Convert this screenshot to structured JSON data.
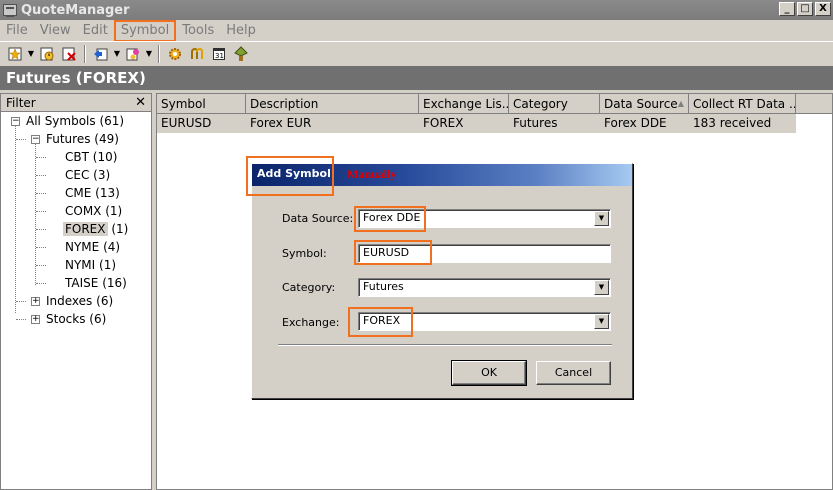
{
  "window": {
    "title": "QuoteManager",
    "buttons": [
      "_",
      "□",
      "X"
    ]
  },
  "menu": {
    "items": [
      "File",
      "View",
      "Edit",
      "Symbol",
      "Tools",
      "Help"
    ],
    "active": "Symbol"
  },
  "toolbar": {
    "icons": [
      "star-document-icon",
      "clock-icon",
      "delete-icon",
      "import-icon",
      "export-icon",
      "gear-icon",
      "split-icon",
      "calendar-icon",
      "plugin-icon"
    ]
  },
  "header": {
    "title": "Futures (FOREX)"
  },
  "filter": {
    "title": "Filter",
    "close": "✕",
    "tree": [
      {
        "label": "All Symbols",
        "count": "(61)"
      },
      {
        "label": "Futures",
        "count": "(49)"
      },
      {
        "label": "CBT",
        "count": "(10)"
      },
      {
        "label": "CEC",
        "count": "(3)"
      },
      {
        "label": "CME",
        "count": "(13)"
      },
      {
        "label": "COMX",
        "count": "(1)"
      },
      {
        "label": "FOREX",
        "count": "(1)"
      },
      {
        "label": "NYME",
        "count": "(4)"
      },
      {
        "label": "NYMI",
        "count": "(1)"
      },
      {
        "label": "TAISE",
        "count": "(16)"
      },
      {
        "label": "Indexes",
        "count": "(6)"
      },
      {
        "label": "Stocks",
        "count": "(6)"
      }
    ]
  },
  "grid": {
    "columns": [
      "Symbol",
      "Description",
      "Exchange Lis...",
      "Category",
      "Data Source",
      "Collect RT Data ..."
    ],
    "sort_indicator": "▲",
    "rows": [
      [
        "EURUSD",
        "Forex EUR",
        "FOREX",
        "Futures",
        "Forex DDE",
        "183 received"
      ]
    ]
  },
  "dialog": {
    "title": "Add Symbol",
    "annotation": "Manually",
    "fields": {
      "data_source": {
        "label": "Data Source:",
        "value": "Forex DDE"
      },
      "symbol": {
        "label": "Symbol:",
        "value": "EURUSD"
      },
      "category": {
        "label": "Category:",
        "value": "Futures"
      },
      "exchange": {
        "label": "Exchange:",
        "value": "FOREX"
      }
    },
    "ok": "OK",
    "cancel": "Cancel"
  },
  "colors": {
    "highlight": "#f07020",
    "dialog_title_start": "#0a246a",
    "dialog_title_end": "#a6caf0",
    "header_bg": "#707070"
  }
}
